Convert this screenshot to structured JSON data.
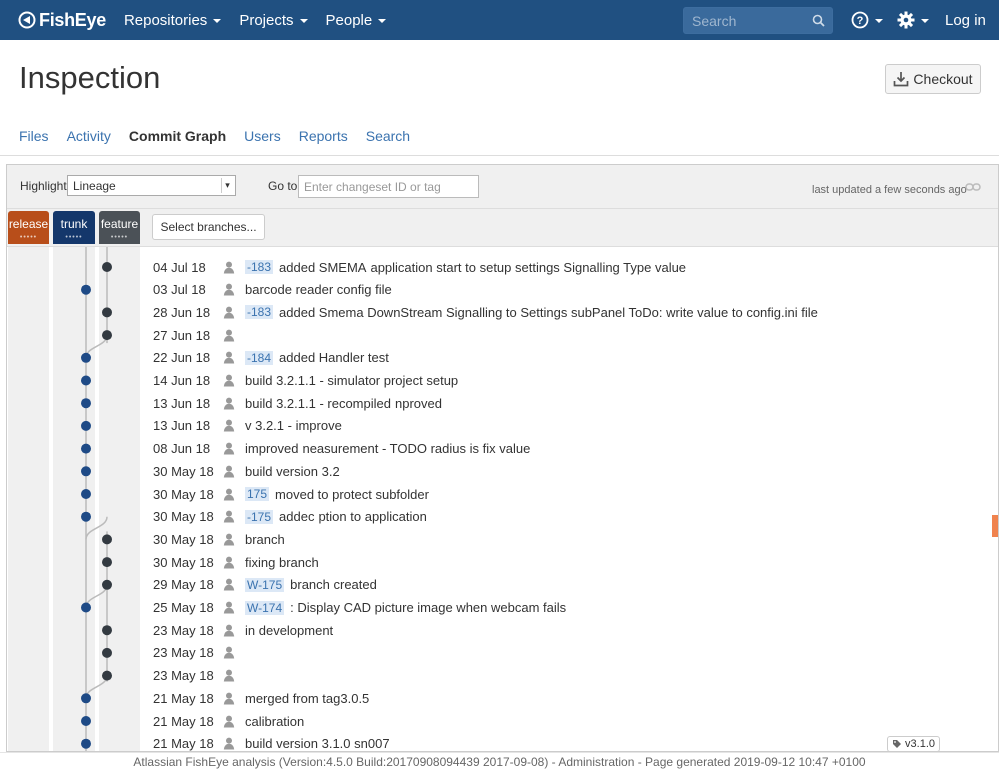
{
  "header": {
    "logo": "FishEye",
    "nav": [
      "Repositories",
      "Projects",
      "People"
    ],
    "search_placeholder": "Search",
    "login": "Log in",
    "bg_color": "#205081"
  },
  "page": {
    "title": "Inspection",
    "checkout_label": "Checkout"
  },
  "tabs": [
    "Files",
    "Activity",
    "Commit Graph",
    "Users",
    "Reports",
    "Search"
  ],
  "active_tab": "Commit Graph",
  "controls": {
    "highlight_label": "Highlight",
    "highlight_value": "Lineage",
    "goto_label": "Go to",
    "goto_placeholder": "Enter changeset ID or tag",
    "last_updated": "last updated a few seconds ago"
  },
  "branches": [
    {
      "name": "release",
      "color": "#b84e1a"
    },
    {
      "name": "trunk",
      "color": "#14376b"
    },
    {
      "name": "feature",
      "color": "#4b5157"
    }
  ],
  "select_branches_label": "Select branches...",
  "commits": [
    {
      "date": "04 Jul 18",
      "issue": "-183",
      "msg": "added SMEMA",
      "msg2": "application start to setup settings Signalling Type value",
      "lane": "feature"
    },
    {
      "date": "03 Jul 18",
      "issue": "",
      "msg": "barcode reader config file",
      "msg2": "",
      "lane": "trunk"
    },
    {
      "date": "28 Jun 18",
      "issue": "-183",
      "msg": "added Smema DownStream Signalling to Settings subPanel ToDo: write value to config.ini file",
      "msg2": "",
      "lane": "feature"
    },
    {
      "date": "27 Jun 18",
      "issue": "",
      "msg": "",
      "msg2": "",
      "lane": "feature"
    },
    {
      "date": "22 Jun 18",
      "issue": "-184",
      "msg": "added Handler test",
      "msg2": "",
      "lane": "trunk"
    },
    {
      "date": "14 Jun 18",
      "issue": "",
      "msg": "build 3.2.1.1 - simulator project setup",
      "msg2": "",
      "lane": "trunk"
    },
    {
      "date": "13 Jun 18",
      "issue": "",
      "msg": "build 3.2.1.1 - recompiled",
      "msg2": "nproved",
      "lane": "trunk"
    },
    {
      "date": "13 Jun 18",
      "issue": "",
      "msg": "v 3.2.1 - improve",
      "msg2": "",
      "lane": "trunk"
    },
    {
      "date": "08 Jun 18",
      "issue": "",
      "msg": "improved",
      "msg2": "neasurement - TODO radius is fix value",
      "lane": "trunk"
    },
    {
      "date": "30 May 18",
      "issue": "",
      "msg": "build version 3.2",
      "msg2": "",
      "lane": "trunk"
    },
    {
      "date": "30 May 18",
      "issue": "175",
      "msg": "moved to protect subfolder",
      "msg2": "",
      "lane": "trunk"
    },
    {
      "date": "30 May 18",
      "issue": "-175",
      "msg": "addec",
      "msg2": "ption to application",
      "lane": "trunk"
    },
    {
      "date": "30 May 18",
      "issue": "",
      "msg": "branch",
      "msg2": "",
      "lane": "feature"
    },
    {
      "date": "30 May 18",
      "issue": "",
      "msg": "fixing branch",
      "msg2": "",
      "lane": "feature"
    },
    {
      "date": "29 May 18",
      "issue": "W-175",
      "msg": "branch created",
      "msg2": "",
      "lane": "feature"
    },
    {
      "date": "25 May 18",
      "issue": "W-174",
      "msg": ": Display CAD picture image when webcam fails",
      "msg2": "",
      "lane": "trunk"
    },
    {
      "date": "23 May 18",
      "issue": "",
      "msg": "in development",
      "msg2": "",
      "lane": "feature"
    },
    {
      "date": "23 May 18",
      "issue": "",
      "msg": "",
      "msg2": "",
      "lane": "feature"
    },
    {
      "date": "23 May 18",
      "issue": "",
      "msg": "",
      "msg2": "",
      "lane": "feature"
    },
    {
      "date": "21 May 18",
      "issue": "",
      "msg": "merged from tag3.0.5",
      "msg2": "",
      "lane": "trunk"
    },
    {
      "date": "21 May 18",
      "issue": "",
      "msg": "calibration",
      "msg2": "",
      "lane": "trunk"
    },
    {
      "date": "21 May 18",
      "issue": "",
      "msg": "build version 3.1.0 sn007",
      "msg2": "",
      "lane": "trunk",
      "tag": "v3.1.0"
    }
  ],
  "footer": "Atlassian FishEye analysis (Version:4.5.0 Build:20170908094439 2017-09-08) - Administration - Page generated 2019-09-12 10:47 +0100"
}
